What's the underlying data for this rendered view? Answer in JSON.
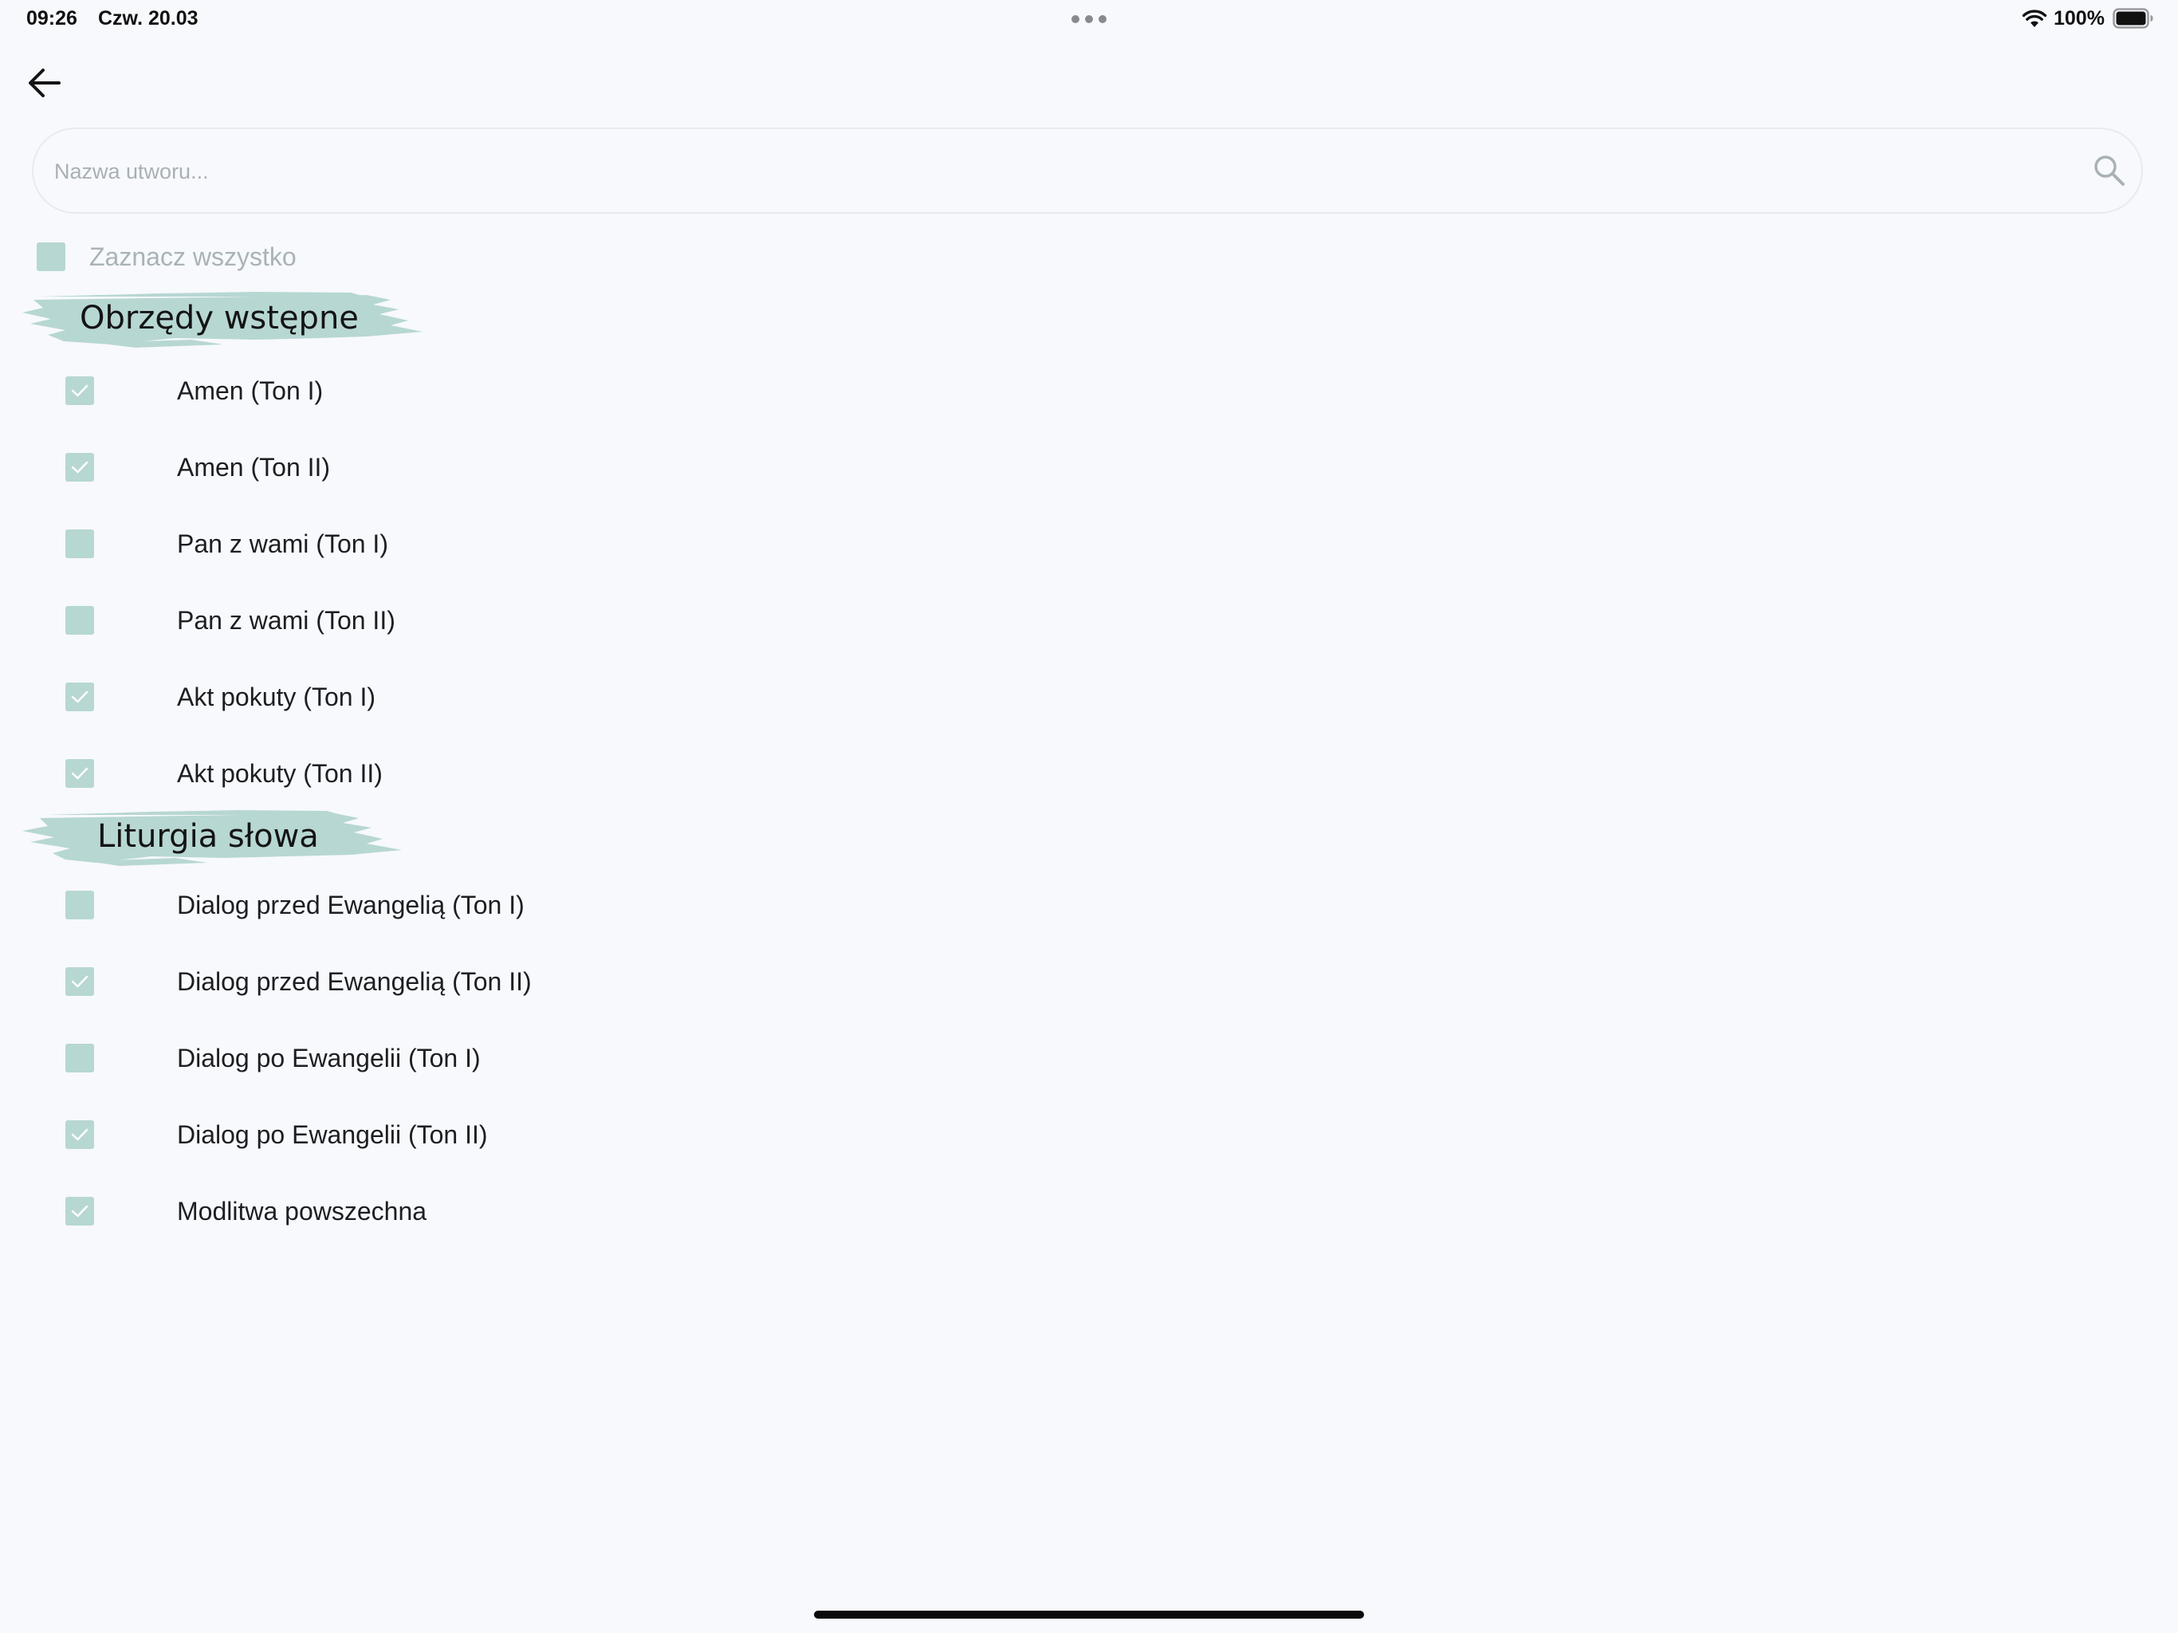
{
  "status_bar": {
    "time": "09:26",
    "date": "Czw. 20.03",
    "battery": "100%"
  },
  "search": {
    "placeholder": "Nazwa utworu...",
    "value": ""
  },
  "select_all": {
    "label": "Zaznacz wszystko",
    "checked": false
  },
  "sections": [
    {
      "title": "Obrzędy wstępne",
      "items": [
        {
          "label": "Amen (Ton I)",
          "checked": true
        },
        {
          "label": "Amen (Ton II)",
          "checked": true
        },
        {
          "label": "Pan z wami (Ton I)",
          "checked": false
        },
        {
          "label": "Pan z wami (Ton II)",
          "checked": false
        },
        {
          "label": "Akt pokuty (Ton I)",
          "checked": true
        },
        {
          "label": "Akt pokuty (Ton II)",
          "checked": true
        }
      ]
    },
    {
      "title": "Liturgia słowa",
      "items": [
        {
          "label": "Dialog przed Ewangelią (Ton I)",
          "checked": false
        },
        {
          "label": "Dialog przed Ewangelią (Ton II)",
          "checked": true
        },
        {
          "label": "Dialog po Ewangelii (Ton I)",
          "checked": false
        },
        {
          "label": "Dialog po Ewangelii (Ton II)",
          "checked": true
        },
        {
          "label": "Modlitwa powszechna",
          "checked": true
        }
      ]
    }
  ],
  "colors": {
    "background": "#f7f9fc",
    "accent": "#b7d7d3",
    "check_mark": "#ffffff",
    "text": "#1e1e22",
    "muted_text": "#a9b3b6"
  }
}
